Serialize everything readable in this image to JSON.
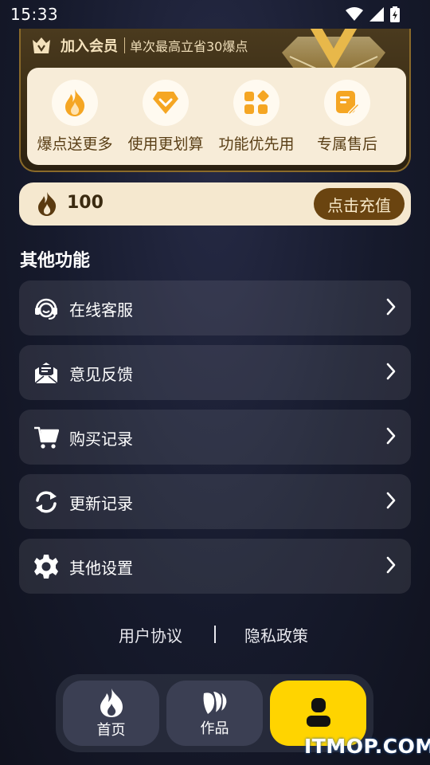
{
  "status_bar": {
    "time": "15:33"
  },
  "vip_card": {
    "title": "加入会员",
    "subtitle": "单次最高立省30爆点",
    "benefits": [
      {
        "label": "爆点送更多",
        "icon": "flame-icon"
      },
      {
        "label": "使用更划算",
        "icon": "diamond-icon"
      },
      {
        "label": "功能优先用",
        "icon": "grid-icon"
      },
      {
        "label": "专属售后",
        "icon": "note-edit-icon"
      }
    ]
  },
  "points": {
    "value": "100",
    "recharge_label": "点击充值"
  },
  "other_functions": {
    "title": "其他功能",
    "items": [
      {
        "label": "在线客服",
        "icon": "headset-icon"
      },
      {
        "label": "意见反馈",
        "icon": "feedback-mail-icon"
      },
      {
        "label": "购买记录",
        "icon": "cart-icon"
      },
      {
        "label": "更新记录",
        "icon": "refresh-icon"
      },
      {
        "label": "其他设置",
        "icon": "gear-icon"
      }
    ]
  },
  "footer": {
    "user_agreement": "用户协议",
    "privacy_policy": "隐私政策"
  },
  "bottom_nav": {
    "items": [
      {
        "label": "首页",
        "icon": "flame-icon"
      },
      {
        "label": "作品",
        "icon": "works-icon"
      },
      {
        "label": "",
        "icon": "user-icon"
      }
    ]
  },
  "watermark": "ITMOP.COM",
  "colors": {
    "accent": "#ffd400",
    "gold_card": "#f7ecd8",
    "brown": "#6a4410",
    "icon_orange": "#f5a623"
  }
}
